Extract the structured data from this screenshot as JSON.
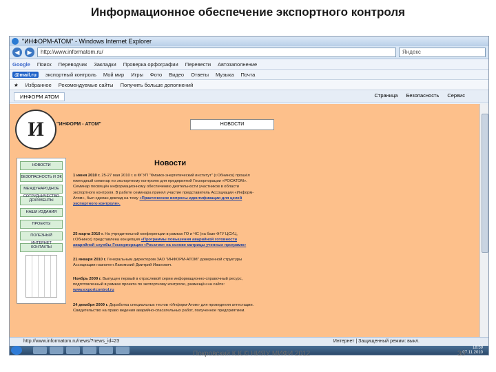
{
  "slide": {
    "title": "Информационное обеспечение экспортного контроля",
    "footer": "Покровский К.К.© НИЯУ МИФИ 2012",
    "page_number": "30"
  },
  "browser": {
    "window_title": "\"ИНФОРМ-АТОМ\" - Windows Internet Explorer",
    "address": "http://www.informatom.ru/",
    "search_placeholder": "Яндекс",
    "toolbar_google": [
      "Google",
      "Поиск",
      "Переводчик",
      "Закладки",
      "Проверка орфографии",
      "Перевести",
      "Автозаполнение"
    ],
    "toolbar_mail": [
      "@mail.ru",
      "экспортный контроль",
      "Мой мир",
      "Игры",
      "Фото",
      "Видео",
      "Ответы",
      "Музыка",
      "Почта"
    ],
    "favorites": [
      "Избранное",
      "Рекомендуемые сайты",
      "Получить больше дополнений"
    ],
    "tab_label": "ИНФОРМ АТОМ",
    "tab_tools": [
      "Страница",
      "Безопасность",
      "Сервис"
    ],
    "status_url": "http://www.informatom.ru/news/?news_id=23",
    "status_zone": "Интернет | Защищенный режим: выкл.",
    "clock_time": "18:59",
    "clock_date": "07.11.2010"
  },
  "site": {
    "logo_letter": "И",
    "logo_text": "\"ИНФОРМ - АТОМ\"",
    "news_button": "НОВОСТИ",
    "heading": "Новости",
    "menu": [
      "НОВОСТИ",
      "БЕЗОПАСНОСТЬ И ЭК",
      "МЕЖДУНАРОДНОЕ СОТРУДНИЧЕСТВО",
      "ДОКУМЕНТЫ",
      "НАШИ ИЗДАНИЯ",
      "ПРОЕКТЫ",
      "ПОЛЕЗНЫЙ ИНТЕРНЕТ",
      "КОНТАКТЫ"
    ],
    "articles": [
      {
        "date": "1 июня 2010 г.",
        "text": "25-27 мая 2010 г. в ФГУП \"Физико-энергетический институт\" (г.Обнинск) прошёл ежегодный семинар по экспортному контролю для предприятий Госкорпорации «РОСАТОМ». Семинар посвящён информационному обеспечению деятельности участников в области экспортного контроля. В работе семинара принял участие представитель Ассоциации «Информ-Атом», был сделан доклад на тему",
        "link": "«Практические вопросы идентификации для целей экспортного контроля»."
      },
      {
        "date": "25 марта 2010 г.",
        "text": "На учредительной конференции в рамках ГО и ЧС (на базе ФГУ ЦСУЦ, г.Обнинск) представлена концепция",
        "link": "«Программы повышения аварийной готовности аварийной службы Госкорпорации «Росатом» на основе матрицы ученных программ»"
      },
      {
        "date": "21 января 2010 г.",
        "text": "Генеральным директором ЗАО \"ИНФОРМ-АТОМ\" доверенной структуры Ассоциации назначен Лакомский Дмитрий Иванович.",
        "link": ""
      },
      {
        "date": "Ноябрь 2009 г.",
        "text": "Выпущен первый в отраслевой серии информационно-справочный ресурс, подготовленный в рамках проекта по экспортному контролю, размещён на сайте:",
        "link": "www.exportcontrol.ru"
      },
      {
        "date": "24 декабря 2009 г.",
        "text": "Доработка специальных тестов «Информ-Атом» для проведения аттестации. Свидетельство на право ведения аварийно-спасательных работ, полученное предприятием.",
        "link": ""
      }
    ]
  }
}
